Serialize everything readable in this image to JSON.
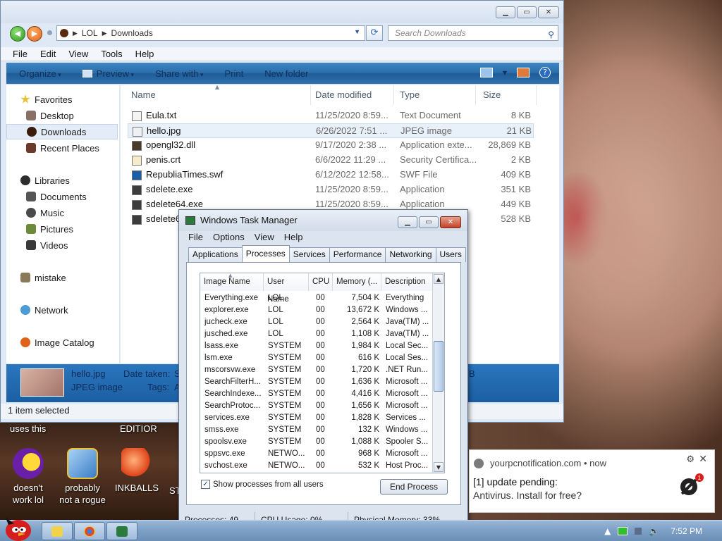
{
  "explorer": {
    "breadcrumb": [
      "LOL",
      "Downloads"
    ],
    "search_placeholder": "Search Downloads",
    "menu": [
      "File",
      "Edit",
      "View",
      "Tools",
      "Help"
    ],
    "commands": [
      "Organize",
      "Preview",
      "Share with",
      "Print",
      "New folder"
    ],
    "nav": {
      "favorites": "Favorites",
      "desktop": "Desktop",
      "downloads": "Downloads",
      "recent": "Recent Places",
      "libraries": "Libraries",
      "documents": "Documents",
      "music": "Music",
      "pictures": "Pictures",
      "videos": "Videos",
      "mistake": "mistake",
      "network": "Network",
      "image_catalog": "Image Catalog"
    },
    "columns": {
      "name": "Name",
      "date": "Date modified",
      "type": "Type",
      "size": "Size"
    },
    "files": [
      {
        "name": "Eula.txt",
        "date": "11/25/2020 8:59...",
        "type": "Text Document",
        "size": "8 KB",
        "icon": "text-file-icon"
      },
      {
        "name": "hello.jpg",
        "date": "6/26/2022 7:51 ...",
        "type": "JPEG image",
        "size": "21 KB",
        "icon": "image-file-icon"
      },
      {
        "name": "opengl32.dll",
        "date": "9/17/2020 2:38 ...",
        "type": "Application exte...",
        "size": "28,869 KB",
        "icon": "dll-file-icon"
      },
      {
        "name": "penis.crt",
        "date": "6/6/2022 11:29 ...",
        "type": "Security Certifica...",
        "size": "2 KB",
        "icon": "certificate-file-icon"
      },
      {
        "name": "RepubliaTimes.swf",
        "date": "6/12/2022 12:58...",
        "type": "SWF File",
        "size": "409 KB",
        "icon": "swf-file-icon"
      },
      {
        "name": "sdelete.exe",
        "date": "11/25/2020 8:59...",
        "type": "Application",
        "size": "351 KB",
        "icon": "exe-file-icon"
      },
      {
        "name": "sdelete64.exe",
        "date": "11/25/2020 8:59...",
        "type": "Application",
        "size": "449 KB",
        "icon": "exe-file-icon"
      },
      {
        "name": "sdelete6",
        "date": "",
        "type": "",
        "size": "528 KB",
        "icon": "exe-file-icon"
      }
    ],
    "details": {
      "filename": "hello.jpg",
      "filetype": "JPEG image",
      "date_label": "Date taken:",
      "date_value": "S",
      "tags_label": "Tags:",
      "tags_value": "A",
      "trailing": "B"
    },
    "status": "1 item selected"
  },
  "taskmgr": {
    "title": "Windows Task Manager",
    "menu": [
      "File",
      "Options",
      "View",
      "Help"
    ],
    "tabs": [
      "Applications",
      "Processes",
      "Services",
      "Performance",
      "Networking",
      "Users"
    ],
    "active_tab": "Processes",
    "columns": [
      "Image Name",
      "User Name",
      "CPU",
      "Memory (...",
      "Description"
    ],
    "processes": [
      {
        "name": "Everything.exe",
        "user": "LOL",
        "cpu": "00",
        "mem": "7,504 K",
        "desc": "Everything"
      },
      {
        "name": "explorer.exe",
        "user": "LOL",
        "cpu": "00",
        "mem": "13,672 K",
        "desc": "Windows ..."
      },
      {
        "name": "jucheck.exe",
        "user": "LOL",
        "cpu": "00",
        "mem": "2,564 K",
        "desc": "Java(TM) ..."
      },
      {
        "name": "jusched.exe",
        "user": "LOL",
        "cpu": "00",
        "mem": "1,108 K",
        "desc": "Java(TM) ..."
      },
      {
        "name": "lsass.exe",
        "user": "SYSTEM",
        "cpu": "00",
        "mem": "1,984 K",
        "desc": "Local Sec..."
      },
      {
        "name": "lsm.exe",
        "user": "SYSTEM",
        "cpu": "00",
        "mem": "616 K",
        "desc": "Local Ses..."
      },
      {
        "name": "mscorsvw.exe",
        "user": "SYSTEM",
        "cpu": "00",
        "mem": "1,720 K",
        "desc": ".NET Run..."
      },
      {
        "name": "SearchFilterH...",
        "user": "SYSTEM",
        "cpu": "00",
        "mem": "1,636 K",
        "desc": "Microsoft ..."
      },
      {
        "name": "SearchIndexe...",
        "user": "SYSTEM",
        "cpu": "00",
        "mem": "4,416 K",
        "desc": "Microsoft ..."
      },
      {
        "name": "SearchProtoc...",
        "user": "SYSTEM",
        "cpu": "00",
        "mem": "1,656 K",
        "desc": "Microsoft ..."
      },
      {
        "name": "services.exe",
        "user": "SYSTEM",
        "cpu": "00",
        "mem": "1,828 K",
        "desc": "Services ..."
      },
      {
        "name": "smss.exe",
        "user": "SYSTEM",
        "cpu": "00",
        "mem": "132 K",
        "desc": "Windows ..."
      },
      {
        "name": "spoolsv.exe",
        "user": "SYSTEM",
        "cpu": "00",
        "mem": "1,088 K",
        "desc": "Spooler S..."
      },
      {
        "name": "sppsvc.exe",
        "user": "NETWO...",
        "cpu": "00",
        "mem": "968 K",
        "desc": "Microsoft ..."
      },
      {
        "name": "svchost.exe",
        "user": "NETWO...",
        "cpu": "00",
        "mem": "532 K",
        "desc": "Host Proc..."
      }
    ],
    "show_all_label": "Show processes from all users",
    "show_all_checked": "✓",
    "end_process": "End Process",
    "status": {
      "processes": "Processes: 49",
      "cpu": "CPU Usage: 0%",
      "memory": "Physical Memory: 33%"
    }
  },
  "desktop_icons": {
    "top_left_label": "uses this",
    "top_mid_label": "EDITIOR",
    "yahoo": [
      "doesn't",
      "work lol"
    ],
    "rogue": [
      "probably",
      "not a rogue"
    ],
    "inkballs": "INKBALLS",
    "cut": "ST"
  },
  "toast": {
    "source": "yourpcnotification.com",
    "sep": "•",
    "time": "now",
    "line1": "[1] update pending:",
    "line2": "Antivirus. Install for free?",
    "badge": "1"
  },
  "taskbar": {
    "clock": "7:52 PM"
  },
  "colors": {
    "cmdbar": "#2b6eac",
    "details": "#1c5fa3",
    "taskbar": "#7c9fc6"
  }
}
